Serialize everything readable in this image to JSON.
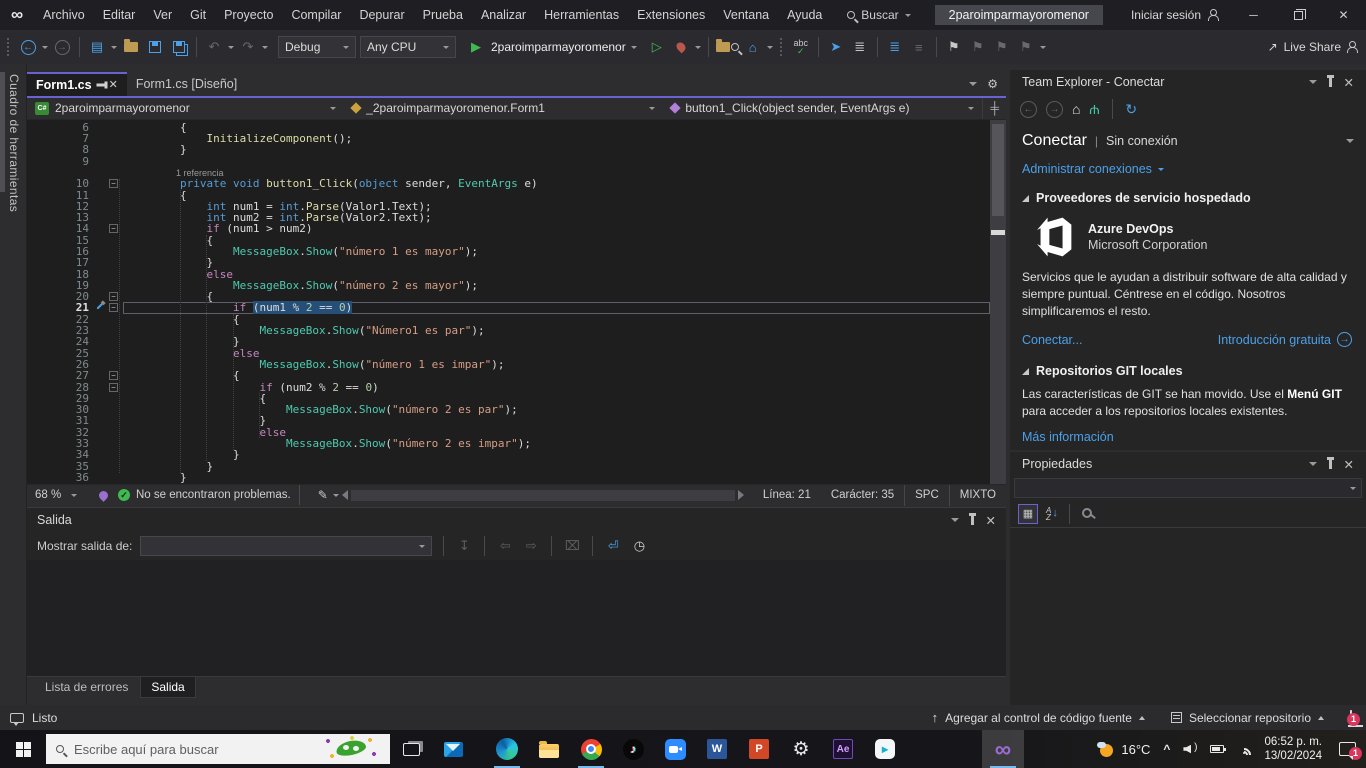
{
  "colors": {
    "accent": "#6962D1",
    "link": "#4BA0E8",
    "run_green": "#3FB950",
    "editor_bg": "#1E1E1E",
    "selection": "#264F78"
  },
  "icons": {
    "vs_logo": "∞",
    "gear": "⚙",
    "close": "✕",
    "minimize": "─",
    "back": "←",
    "forward": "→",
    "undo": "↶",
    "redo": "↷",
    "run": "▶",
    "run_outline": "▷",
    "home": "⌂",
    "refresh": "↻",
    "plug": "Ψ",
    "bookmark": "⚑",
    "split": "╪",
    "nav_down": "↧",
    "nav_left": "⇦",
    "nav_right": "⇨",
    "clear": "⌧",
    "wrap": "⏎",
    "clock": "◷",
    "categorized": "▦",
    "sort_down": "↓",
    "fold_minus": "−",
    "live_share_arrow": "↗",
    "check": "✓",
    "wand": "✎",
    "comment": "≣",
    "uncomment": "≡",
    "spell": "abc",
    "pointer": "➤",
    "intro_arrow": "→"
  },
  "titlebar": {
    "menus": [
      "Archivo",
      "Editar",
      "Ver",
      "Git",
      "Proyecto",
      "Compilar",
      "Depurar",
      "Prueba",
      "Analizar",
      "Herramientas",
      "Extensiones",
      "Ventana",
      "Ayuda"
    ],
    "search_label": "Buscar",
    "search_value": "2paroimparmayoromenor",
    "signin_label": "Iniciar sesión"
  },
  "toolbar": {
    "config": "Debug",
    "platform": "Any CPU",
    "run_label": "2paroimparmayoromenor",
    "live_share_label": "Live Share"
  },
  "editor": {
    "toolbox_label": "Cuadro de herramientas",
    "tabs": [
      {
        "label": "Form1.cs",
        "active": true
      },
      {
        "label": "Form1.cs [Diseño]",
        "active": false
      }
    ],
    "breadcrumb": {
      "project": "2paroimparmayoromenor",
      "type": "_2paroimparmayoromenor.Form1",
      "member": "button1_Click(object sender, EventArgs e)"
    },
    "lines": [
      {
        "n": 6,
        "tk": [
          [
            "p",
            "        {"
          ]
        ]
      },
      {
        "n": 7,
        "tk": [
          [
            "p",
            "            "
          ],
          [
            "m",
            "InitializeComponent"
          ],
          [
            "p",
            "();"
          ]
        ]
      },
      {
        "n": 8,
        "tk": [
          [
            "p",
            "        }"
          ]
        ]
      },
      {
        "n": 9,
        "tk": []
      },
      {
        "lens": "1 referencia"
      },
      {
        "n": 10,
        "f": 1,
        "tk": [
          [
            "p",
            "        "
          ],
          [
            "k",
            "private"
          ],
          [
            "p",
            " "
          ],
          [
            "k",
            "void"
          ],
          [
            "p",
            " "
          ],
          [
            "m",
            "button1_Click"
          ],
          [
            "p",
            "("
          ],
          [
            "k",
            "object"
          ],
          [
            "p",
            " sender, "
          ],
          [
            "t",
            "EventArgs"
          ],
          [
            "p",
            " e)"
          ]
        ]
      },
      {
        "n": 11,
        "tk": [
          [
            "p",
            "        {"
          ]
        ]
      },
      {
        "n": 12,
        "tk": [
          [
            "p",
            "            "
          ],
          [
            "k",
            "int"
          ],
          [
            "p",
            " num1 = "
          ],
          [
            "k",
            "int"
          ],
          [
            "p",
            "."
          ],
          [
            "m",
            "Parse"
          ],
          [
            "p",
            "(Valor1.Text);"
          ]
        ]
      },
      {
        "n": 13,
        "tk": [
          [
            "p",
            "            "
          ],
          [
            "k",
            "int"
          ],
          [
            "p",
            " num2 = "
          ],
          [
            "k",
            "int"
          ],
          [
            "p",
            "."
          ],
          [
            "m",
            "Parse"
          ],
          [
            "p",
            "(Valor2.Text);"
          ]
        ]
      },
      {
        "n": 14,
        "f": 1,
        "tk": [
          [
            "p",
            "            "
          ],
          [
            "c",
            "if"
          ],
          [
            "p",
            " (num1 > num2)"
          ]
        ]
      },
      {
        "n": 15,
        "tk": [
          [
            "p",
            "            {"
          ]
        ]
      },
      {
        "n": 16,
        "tk": [
          [
            "p",
            "                "
          ],
          [
            "t",
            "MessageBox"
          ],
          [
            "p",
            "."
          ],
          [
            "t",
            "Show"
          ],
          [
            "p",
            "("
          ],
          [
            "s",
            "\"número 1 es mayor\""
          ],
          [
            "p",
            ");"
          ]
        ]
      },
      {
        "n": 17,
        "tk": [
          [
            "p",
            "            }"
          ]
        ]
      },
      {
        "n": 18,
        "tk": [
          [
            "p",
            "            "
          ],
          [
            "c",
            "else"
          ]
        ]
      },
      {
        "n": 19,
        "tk": [
          [
            "p",
            "                "
          ],
          [
            "t",
            "MessageBox"
          ],
          [
            "p",
            "."
          ],
          [
            "t",
            "Show"
          ],
          [
            "p",
            "("
          ],
          [
            "s",
            "\"número 2 es mayor\""
          ],
          [
            "p",
            ");"
          ]
        ]
      },
      {
        "n": 20,
        "f": 1,
        "tk": [
          [
            "p",
            "            {"
          ]
        ]
      },
      {
        "n": 21,
        "f": 1,
        "cur": 1,
        "fix": 1,
        "tk": [
          [
            "p",
            "                "
          ],
          [
            "c",
            "if"
          ],
          [
            "p",
            " "
          ],
          [
            "ps",
            "(num1 % "
          ],
          [
            "ns",
            "2"
          ],
          [
            "ps",
            " == "
          ],
          [
            "ns",
            "0"
          ],
          [
            "ps",
            ")"
          ]
        ]
      },
      {
        "n": 22,
        "tk": [
          [
            "p",
            "                {"
          ]
        ]
      },
      {
        "n": 23,
        "tk": [
          [
            "p",
            "                    "
          ],
          [
            "t",
            "MessageBox"
          ],
          [
            "p",
            "."
          ],
          [
            "t",
            "Show"
          ],
          [
            "p",
            "("
          ],
          [
            "s",
            "\"Número1 es par\""
          ],
          [
            "p",
            ");"
          ]
        ]
      },
      {
        "n": 24,
        "tk": [
          [
            "p",
            "                }"
          ]
        ]
      },
      {
        "n": 25,
        "tk": [
          [
            "p",
            "                "
          ],
          [
            "c",
            "else"
          ]
        ]
      },
      {
        "n": 26,
        "tk": [
          [
            "p",
            "                    "
          ],
          [
            "t",
            "MessageBox"
          ],
          [
            "p",
            "."
          ],
          [
            "t",
            "Show"
          ],
          [
            "p",
            "("
          ],
          [
            "s",
            "\"número 1 es impar\""
          ],
          [
            "p",
            ");"
          ]
        ]
      },
      {
        "n": 27,
        "f": 1,
        "tk": [
          [
            "p",
            "                {"
          ]
        ]
      },
      {
        "n": 28,
        "f": 1,
        "tk": [
          [
            "p",
            "                    "
          ],
          [
            "c",
            "if"
          ],
          [
            "p",
            " (num2 % "
          ],
          [
            "n",
            "2"
          ],
          [
            "p",
            " == "
          ],
          [
            "n",
            "0"
          ],
          [
            "p",
            ")"
          ]
        ]
      },
      {
        "n": 29,
        "tk": [
          [
            "p",
            "                    {"
          ]
        ]
      },
      {
        "n": 30,
        "tk": [
          [
            "p",
            "                        "
          ],
          [
            "t",
            "MessageBox"
          ],
          [
            "p",
            "."
          ],
          [
            "t",
            "Show"
          ],
          [
            "p",
            "("
          ],
          [
            "s",
            "\"número 2 es par\""
          ],
          [
            "p",
            ");"
          ]
        ]
      },
      {
        "n": 31,
        "tk": [
          [
            "p",
            "                    }"
          ]
        ]
      },
      {
        "n": 32,
        "tk": [
          [
            "p",
            "                    "
          ],
          [
            "c",
            "else"
          ]
        ]
      },
      {
        "n": 33,
        "tk": [
          [
            "p",
            "                        "
          ],
          [
            "t",
            "MessageBox"
          ],
          [
            "p",
            "."
          ],
          [
            "t",
            "Show"
          ],
          [
            "p",
            "("
          ],
          [
            "s",
            "\"número 2 es impar\""
          ],
          [
            "p",
            ");"
          ]
        ]
      },
      {
        "n": 34,
        "tk": [
          [
            "p",
            "                }"
          ]
        ]
      },
      {
        "n": 35,
        "tk": [
          [
            "p",
            "            }"
          ]
        ]
      },
      {
        "n": 36,
        "tk": [
          [
            "p",
            "        }"
          ]
        ]
      }
    ],
    "status": {
      "zoom": "68 %",
      "problems": "No se encontraron problemas.",
      "line": "Línea: 21",
      "column": "Carácter: 35",
      "encoding": "SPC",
      "line_endings": "MIXTO"
    }
  },
  "output": {
    "title": "Salida",
    "show_label": "Mostrar salida de:",
    "combo_value": ""
  },
  "panel_tabs": [
    {
      "label": "Lista de errores",
      "active": false
    },
    {
      "label": "Salida",
      "active": true
    }
  ],
  "statusbar": {
    "ready": "Listo",
    "add_to_source": "Agregar al control de código fuente",
    "select_repo": "Seleccionar repositorio",
    "notifications_badge": "1"
  },
  "team": {
    "title": "Team Explorer - Conectar",
    "heading": "Conectar",
    "heading_sub": "Sin conexión",
    "manage_link": "Administrar conexiones",
    "section_hosted": "Proveedores de servicio hospedado",
    "azure": {
      "name": "Azure DevOps",
      "org": "Microsoft Corporation",
      "description": "Servicios que le ayudan a distribuir software de alta calidad y siempre puntual. Céntrese en el código. Nosotros simplificaremos el resto.",
      "connect_link": "Conectar...",
      "intro_link": "Introducción gratuita"
    },
    "section_git": "Repositorios GIT locales",
    "git_text_pre": "Las características de GIT se han movido. Use el ",
    "git_text_bold": "Menú GIT",
    "git_text_post": " para acceder a los repositorios locales existentes.",
    "more_link": "Más información"
  },
  "properties": {
    "title": "Propiedades"
  },
  "taskbar": {
    "search_placeholder": "Escribe aquí para buscar",
    "apps": [
      {
        "id": "taskview",
        "label": "task-view"
      },
      {
        "id": "mail",
        "label": "mail"
      },
      {
        "id": "edge",
        "label": "edge",
        "running": true
      },
      {
        "id": "explorer",
        "label": "file-explorer"
      },
      {
        "id": "chrome",
        "label": "chrome",
        "running": true
      },
      {
        "id": "tiktok",
        "label": "tiktok"
      },
      {
        "id": "zoom",
        "label": "zoom"
      },
      {
        "id": "word",
        "label": "word"
      },
      {
        "id": "powerpoint",
        "label": "powerpoint"
      },
      {
        "id": "settings",
        "label": "settings"
      },
      {
        "id": "aftereffects",
        "label": "after-effects"
      },
      {
        "id": "clipchamp",
        "label": "clipchamp"
      },
      {
        "id": "visualstudio",
        "label": "visual-studio",
        "active": true
      }
    ],
    "tray": {
      "temperature": "16°C",
      "time": "06:52 p. m.",
      "date": "13/02/2024",
      "badge": "1"
    }
  }
}
